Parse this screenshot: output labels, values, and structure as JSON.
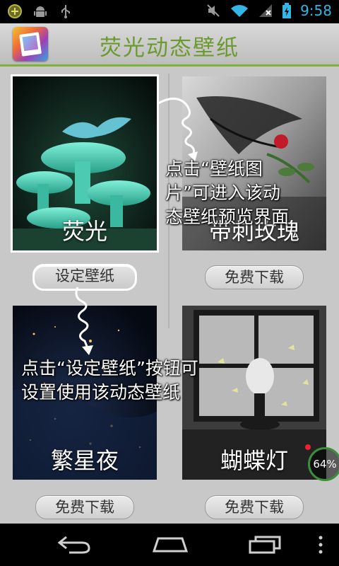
{
  "status_bar": {
    "time": "9:58",
    "icons_left": [
      "android-debug-icon",
      "android-robot-icon",
      "usb-icon"
    ],
    "icons_right": [
      "mute-icon",
      "wifi-icon",
      "signal-x-icon",
      "battery-charging-icon"
    ]
  },
  "app": {
    "title": "荧光动态壁纸",
    "accent": "#6b9a2e"
  },
  "wallpapers": [
    {
      "name": "荧光",
      "button_label": "设定壁纸"
    },
    {
      "name": "带刺玫瑰",
      "button_label": "免费下载"
    },
    {
      "name": "繁星夜",
      "button_label": "免费下载"
    },
    {
      "name": "蝴蝶灯",
      "button_label": "免费下载"
    }
  ],
  "annotations": {
    "tap_image": [
      "点击“壁纸图",
      "片”可进入该动",
      "态壁纸预览界面"
    ],
    "tap_button": [
      "点击“设定壁纸”按钮可",
      "设置使用该动态壁纸"
    ]
  },
  "download_progress": "64%",
  "nav_bar": {
    "icons": [
      "back-icon",
      "home-icon",
      "recent-apps-icon",
      "menu-icon"
    ]
  }
}
